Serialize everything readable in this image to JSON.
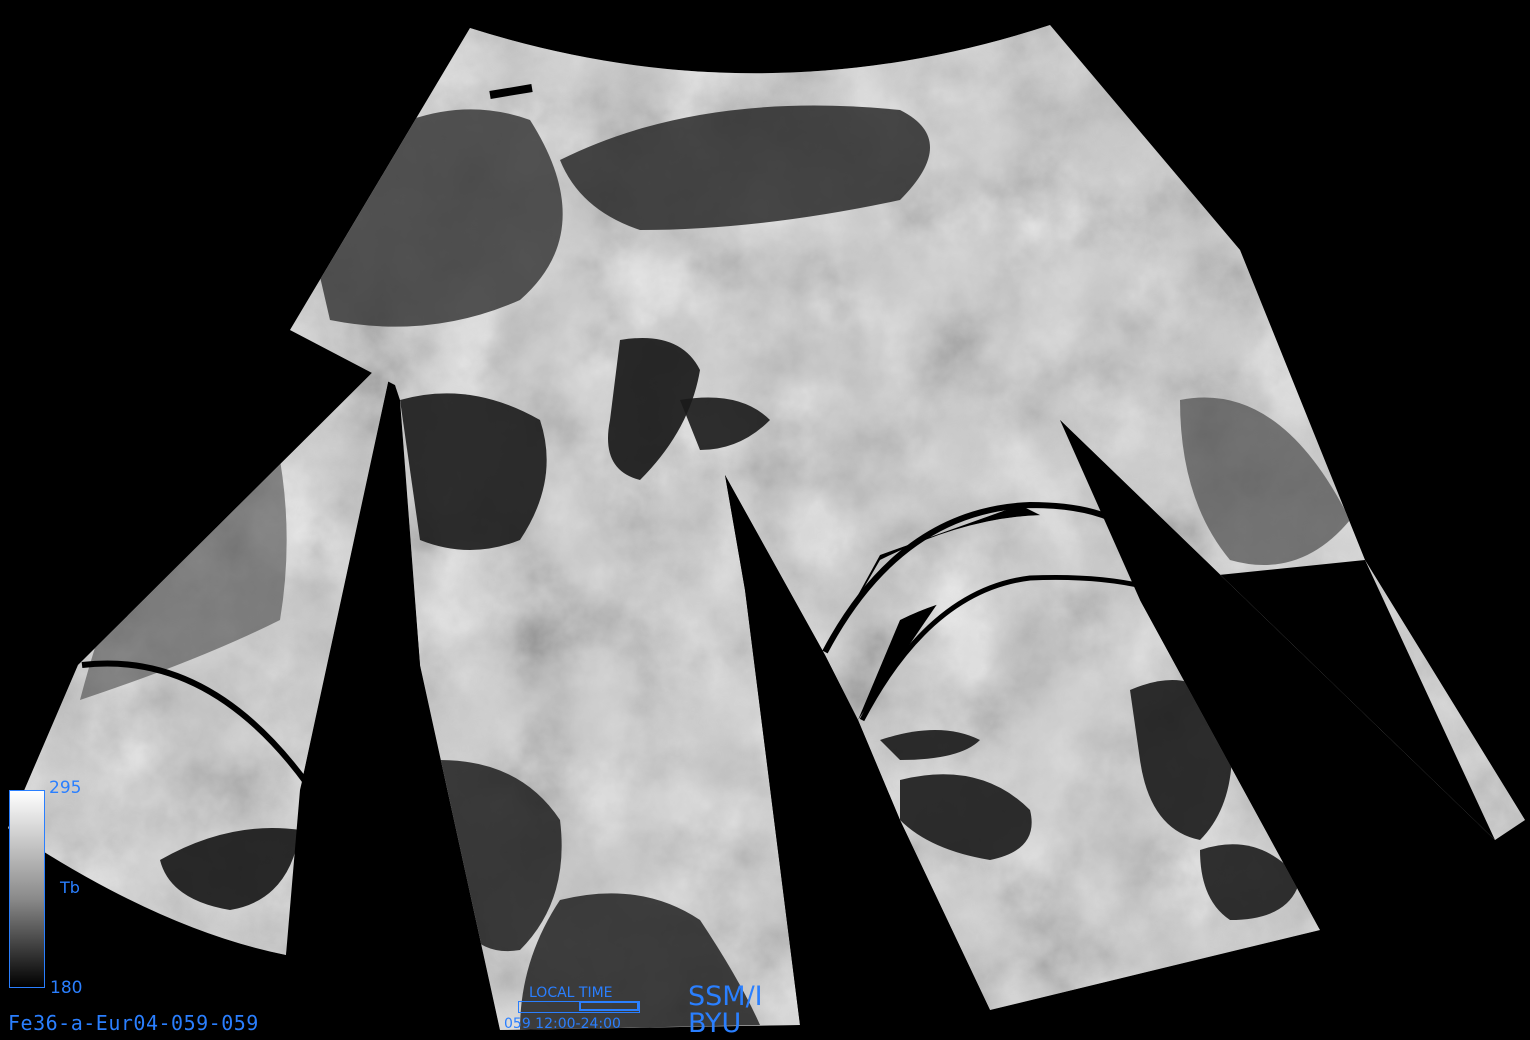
{
  "colorbar": {
    "max_label": "295",
    "min_label": "180",
    "variable_label": "Tb"
  },
  "filename": "Fe36-a-Eur04-059-059",
  "local_time": {
    "title": "LOCAL  TIME",
    "range": "059  12:00-24:00",
    "filled_fraction": 0.5
  },
  "sensor": "SSM/I",
  "institution": "BYU",
  "colors": {
    "annotation": "#2a7fff",
    "background": "#000000"
  }
}
